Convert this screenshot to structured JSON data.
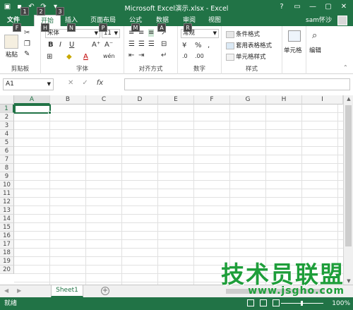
{
  "window": {
    "title": "Microsoft Excel演示.xlsx - Excel",
    "controls": [
      "?",
      "▭",
      "—",
      "▢",
      "✕"
    ]
  },
  "tabs": {
    "file": "文件",
    "items": [
      "开始",
      "插入",
      "页面布局",
      "公式",
      "数据",
      "审阅",
      "视图"
    ],
    "active": "开始",
    "user": "sam怀沙"
  },
  "keytips": {
    "qat1": "1",
    "qat2": "2",
    "qat3": "3",
    "file": "F",
    "home": "H",
    "insert": "N",
    "layout": "P",
    "formulas": "M",
    "data": "A",
    "review": "R"
  },
  "ribbon": {
    "clipboard": {
      "label": "剪贴板",
      "paste": "粘贴"
    },
    "font": {
      "label": "字体",
      "name": "宋体",
      "size": "11",
      "bold": "B",
      "italic": "I",
      "underline": "U"
    },
    "alignment": {
      "label": "对齐方式"
    },
    "number": {
      "label": "数字",
      "format": "常规"
    },
    "styles": {
      "label": "样式",
      "conditional": "条件格式",
      "table": "套用表格格式",
      "cell": "单元格样式"
    },
    "cells": {
      "label": "单元格"
    },
    "editing": {
      "label": "编辑"
    }
  },
  "formula_bar": {
    "name_box": "A1",
    "fx": "fx"
  },
  "sheet": {
    "columns": [
      "A",
      "B",
      "C",
      "D",
      "E",
      "F",
      "G",
      "H",
      "I"
    ],
    "rows": [
      "1",
      "2",
      "3",
      "4",
      "5",
      "6",
      "7",
      "8",
      "9",
      "10",
      "11",
      "12",
      "13",
      "14",
      "15",
      "16",
      "17",
      "18",
      "19",
      "20"
    ],
    "active_cell": "A1"
  },
  "sheet_tabs": {
    "tabs": [
      "Sheet1"
    ],
    "active": "Sheet1"
  },
  "status": {
    "ready": "就绪",
    "zoom": "100%"
  },
  "watermark": {
    "cn": "技术员联盟",
    "url": "www.jsgho.com"
  },
  "colors": {
    "accent": "#217346",
    "watermark": "#1e9e3a"
  }
}
